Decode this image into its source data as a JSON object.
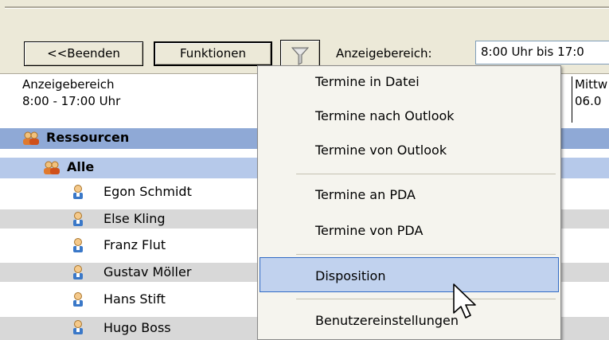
{
  "toolbar": {
    "exit_label": "<<Beenden",
    "functions_label": "Funktionen",
    "display_range_label": "Anzeigebereich:",
    "display_range_value": "8:00 Uhr bis 17:0"
  },
  "header": {
    "area_title": "Anzeigebereich",
    "area_value": "8:00 - 17:00 Uhr",
    "day_name": "Mittw",
    "day_date": "06.0"
  },
  "tree": {
    "root": "Ressourcen",
    "group": "Alle",
    "people": [
      "Egon Schmidt",
      "Else Kling",
      "Franz Flut",
      "Gustav Möller",
      "Hans Stift",
      "Hugo Boss"
    ]
  },
  "menu": {
    "items": [
      "Termine in Datei",
      "Termine nach Outlook",
      "Termine von Outlook",
      "Termine an PDA",
      "Termine von PDA",
      "Disposition",
      "Benutzereinstellungen"
    ],
    "highlighted": "Disposition"
  },
  "colors": {
    "group_root_bg": "#8fa9d6",
    "group_bg": "#b6c9ea",
    "alt_row_bg": "#d8d8d8",
    "menu_highlight": "#c1d2ee"
  }
}
